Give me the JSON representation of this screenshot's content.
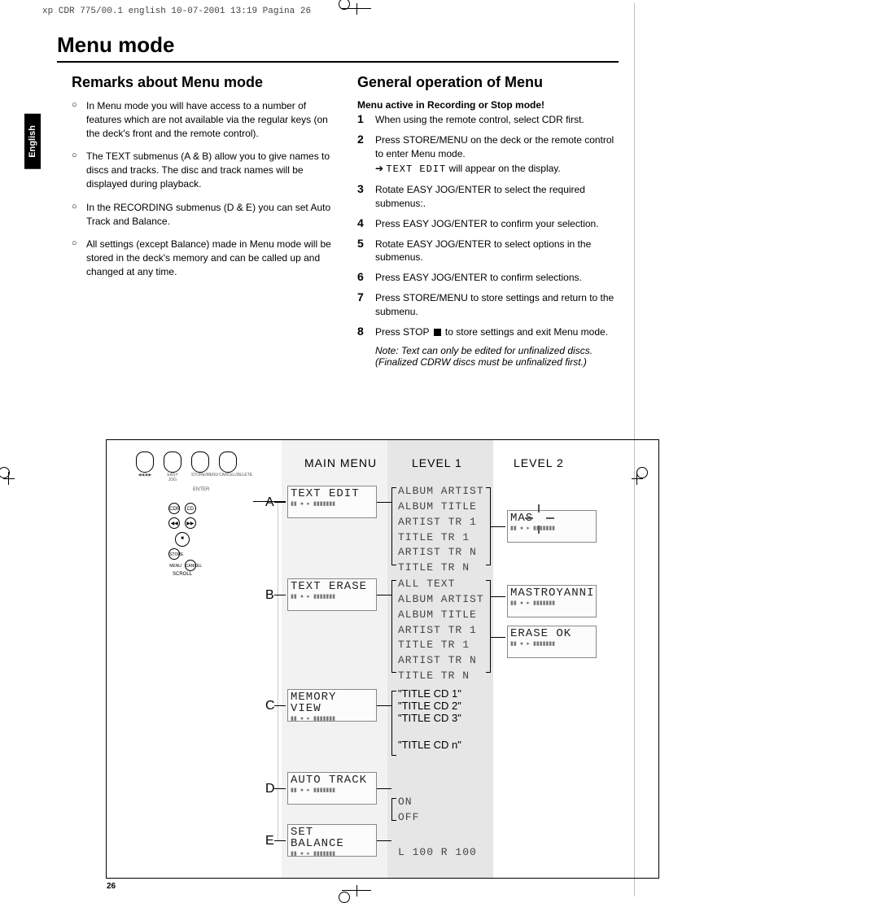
{
  "crop_header": "xp CDR 775/00.1 english  10-07-2001 13:19  Pagina 26",
  "lang_tab": "English",
  "h1": "Menu mode",
  "page_number": "26",
  "left": {
    "heading": "Remarks about Menu mode",
    "items": [
      "In Menu mode you will have access to a number of features which are not available via the regular keys (on the deck's front and the remote control).",
      "The TEXT submenus (A & B) allow you to give names to discs and tracks. The disc and track names will be displayed during playback.",
      "In the RECORDING submenus (D & E) you can set Auto Track and Balance.",
      "All settings (except Balance) made in Menu mode will be stored in the deck's memory and can be called up and changed at any time."
    ]
  },
  "right": {
    "heading": "General operation of Menu",
    "redline": "Menu active in Recording or Stop mode!",
    "steps": [
      "When using the remote control, select CDR first.",
      "Press STORE/MENU on the deck or the remote control to enter Menu mode.",
      "Rotate EASY JOG/ENTER to select the required submenus:.",
      "Press EASY JOG/ENTER to confirm your selection.",
      "Rotate EASY JOG/ENTER to select options in the submenus.",
      "Press EASY JOG/ENTER to confirm selections.",
      "Press STORE/MENU to store settings and return to the submenu.",
      "Press STOP ■ to store settings and exit Menu mode."
    ],
    "step2_arrow": "➔",
    "step2_display": "TEXT EDIT",
    "step2_suffix": " will appear on the display.",
    "note": "Note: Text can only be edited for unfinalized discs. (Finalized CDRW discs must be unfinalized first.)"
  },
  "diagram": {
    "head_main": "MAIN MENU",
    "head_l1": "LEVEL 1",
    "head_l2": "LEVEL 2",
    "labels": [
      "A",
      "B",
      "C",
      "D",
      "E"
    ],
    "mainmenu": [
      "TEXT EDIT",
      "TEXT ERASE",
      "MEMORY VIEW",
      "AUTO TRACK",
      "SET BALANCE"
    ],
    "levelA": [
      "ALBUM ARTIST",
      "ALBUM TITLE",
      "ARTIST TR 1",
      "TITLE TR 1",
      "ARTIST TR N",
      "TITLE TR N"
    ],
    "levelB": [
      "ALL TEXT",
      "ALBUM ARTIST",
      "ALBUM TITLE",
      "ARTIST TR 1",
      "TITLE TR 1",
      "ARTIST TR N",
      "TITLE TR N"
    ],
    "levelC": [
      "\"TITLE CD 1\"",
      "\"TITLE CD 2\"",
      "\"TITLE CD 3\"",
      "",
      "\"TITLE CD n\""
    ],
    "levelD": [
      "ON",
      "OFF"
    ],
    "levelE": [
      "L 100 R 100"
    ],
    "lvl2A": "MAS",
    "lvl2B1": "MASTROYANNI",
    "lvl2B2": "ERASE OK",
    "ctl_labels": {
      "jog": "EASY JOG",
      "store": "STORE/MENU",
      "cancel": "CANCEL/DELETE",
      "enter": "ENTER",
      "cdr": "CDR",
      "cd": "CD",
      "stop": "■",
      "menu": "STORE/MENU",
      "del": "CANCEL",
      "scroll": "SCROLL"
    }
  }
}
